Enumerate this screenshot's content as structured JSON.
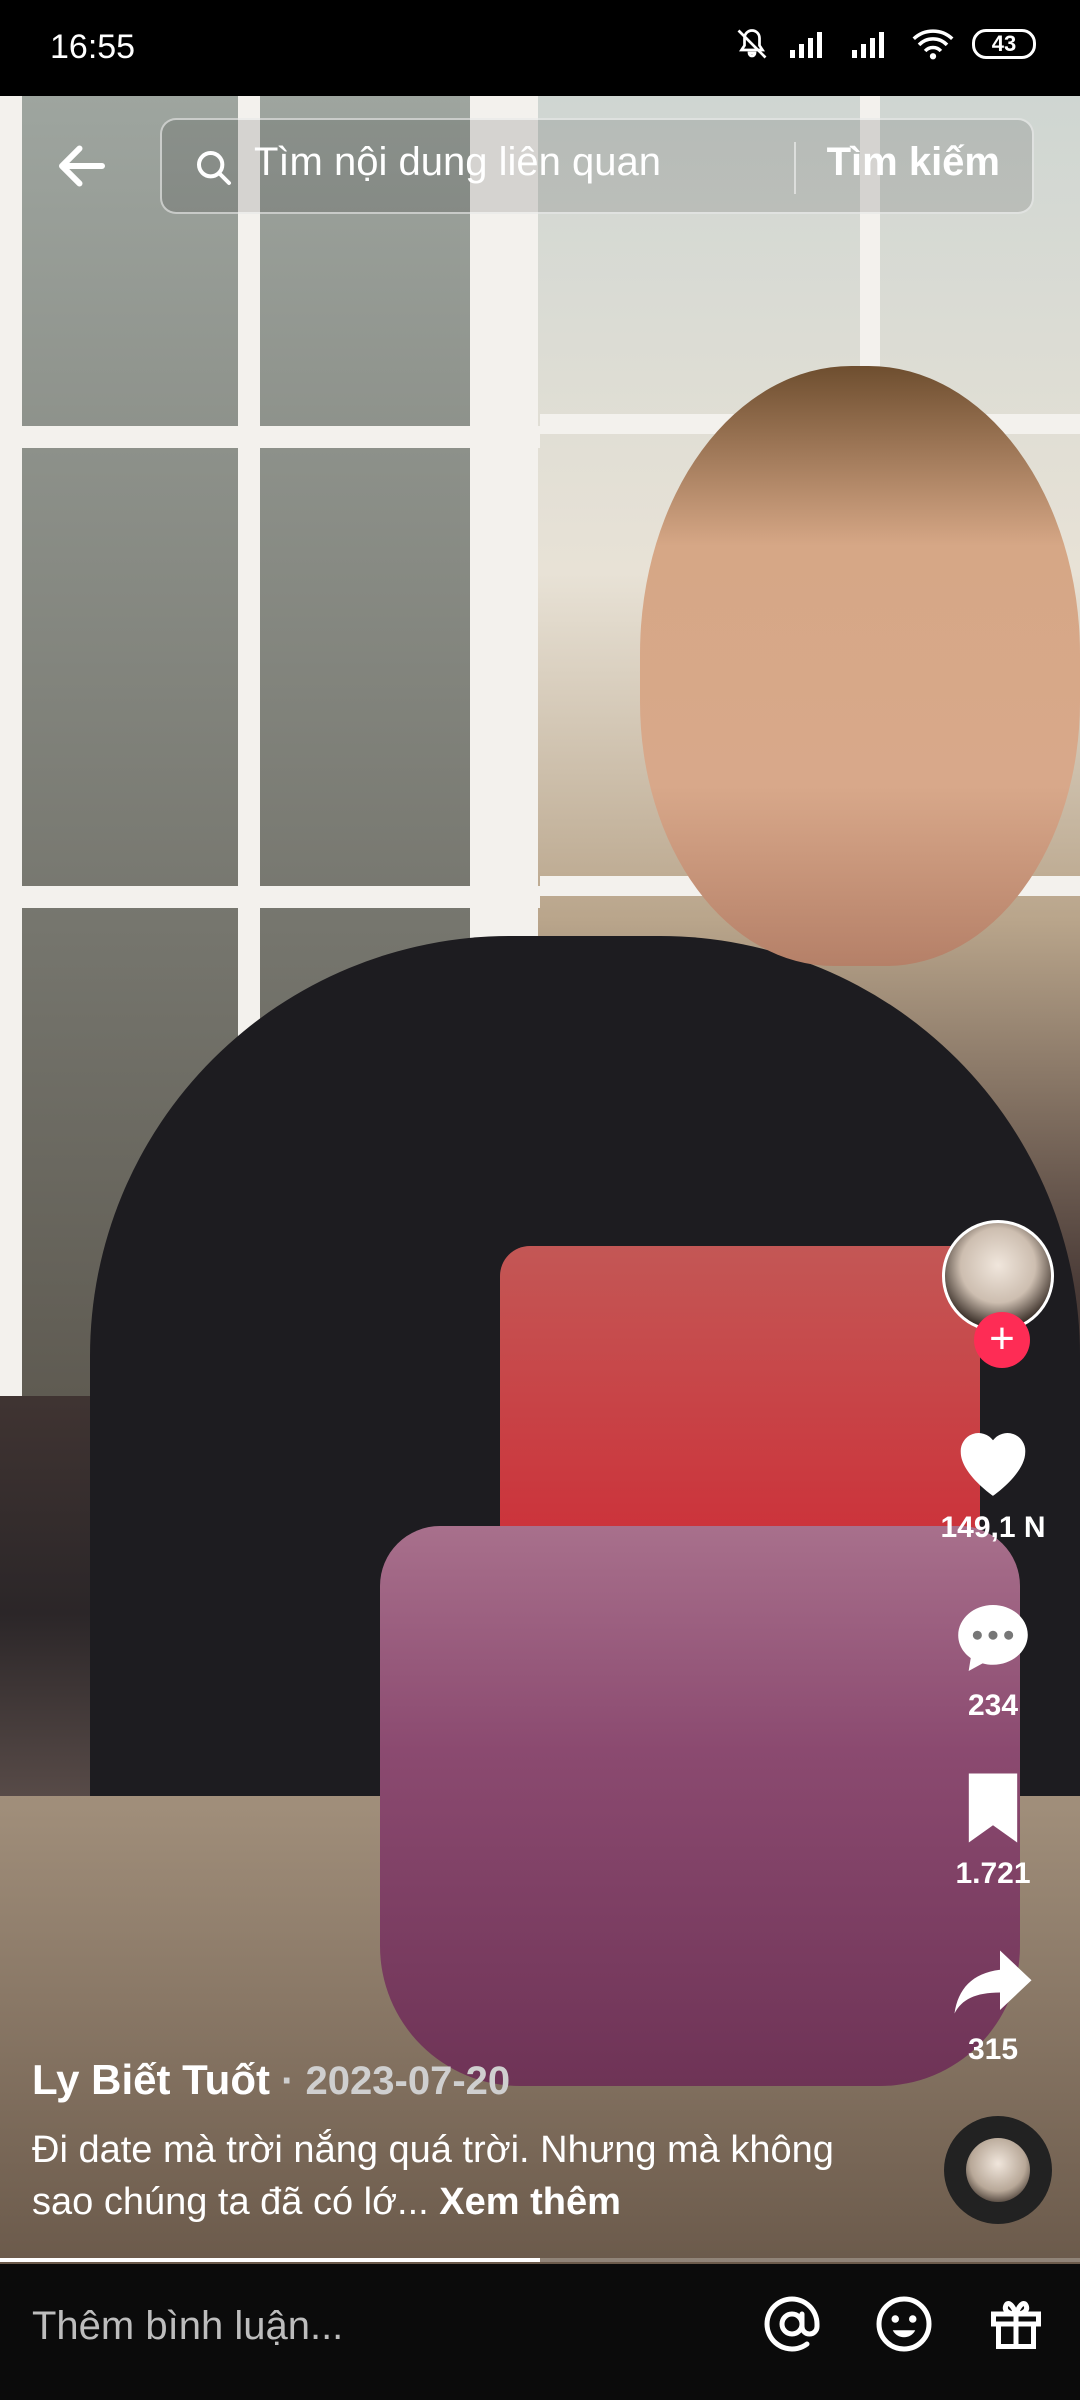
{
  "status_bar": {
    "time": "16:55",
    "battery": "43"
  },
  "search": {
    "placeholder": "Tìm nội dung liên quan",
    "button": "Tìm kiếm"
  },
  "video": {
    "author": "Ly Biết Tuốt",
    "date_prefix": " · ",
    "date": "2023-07-20",
    "description": "Đi date mà trời nắng quá trời. Nhưng mà không sao chúng ta đã có lớ...",
    "see_more": "Xem thêm",
    "progress": 0.5
  },
  "actions": {
    "likes": "149,1 N",
    "comments": "234",
    "saves": "1.721",
    "shares": "315"
  },
  "comment_bar": {
    "placeholder": "Thêm bình luận..."
  },
  "icons": [
    "back-arrow-icon",
    "search-icon",
    "heart-icon",
    "comment-icon",
    "bookmark-icon",
    "share-icon",
    "mention-icon",
    "emoji-icon",
    "gift-icon"
  ]
}
